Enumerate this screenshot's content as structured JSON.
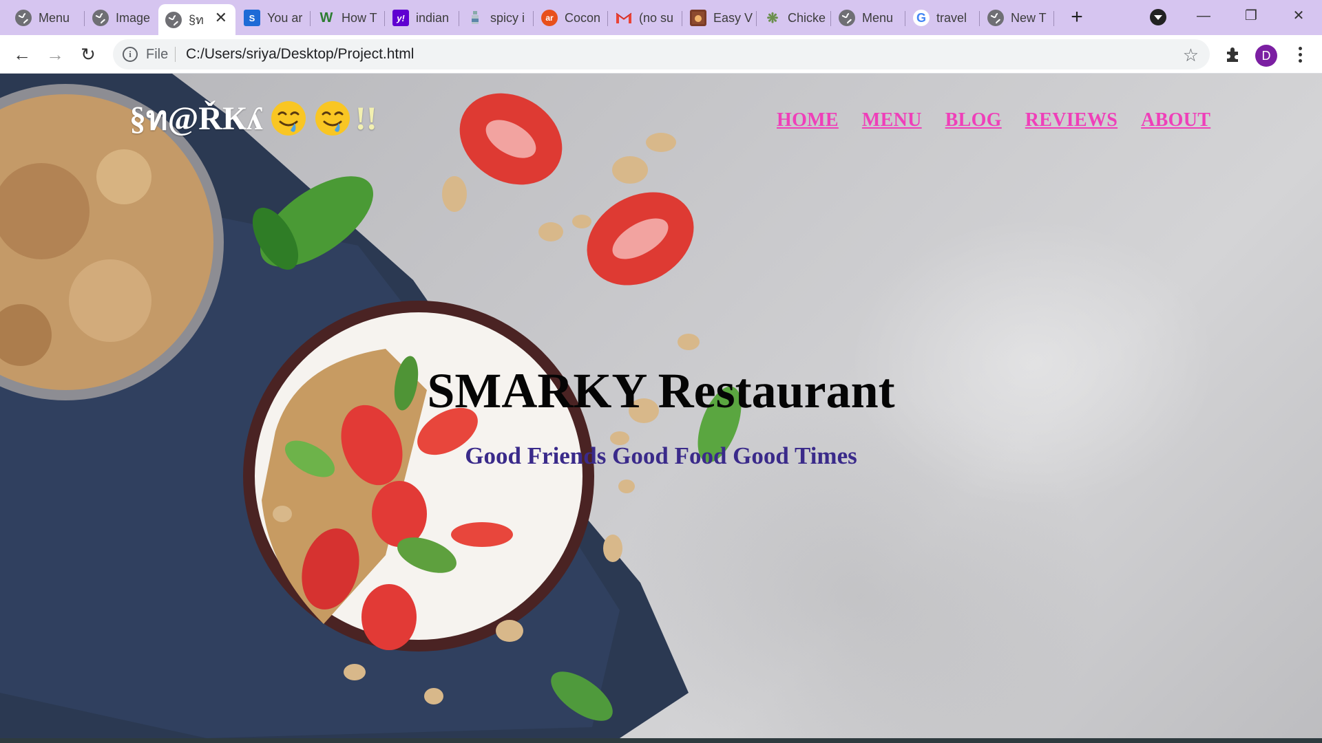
{
  "browser": {
    "tabs": [
      {
        "title": "Menu",
        "favicon": "globe-icon"
      },
      {
        "title": "Image",
        "favicon": "globe-icon"
      },
      {
        "title": "§ท",
        "favicon": "globe-icon",
        "active": true
      },
      {
        "title": "You ar",
        "favicon": "s-icon"
      },
      {
        "title": "How T",
        "favicon": "w-icon"
      },
      {
        "title": "indian",
        "favicon": "yahoo-icon"
      },
      {
        "title": "spicy i",
        "favicon": "bottle-icon"
      },
      {
        "title": "Cocon",
        "favicon": "allrecipes-icon"
      },
      {
        "title": "(no su",
        "favicon": "gmail-icon"
      },
      {
        "title": "Easy V",
        "favicon": "image-icon"
      },
      {
        "title": "Chicke",
        "favicon": "leaf-icon"
      },
      {
        "title": "Menu",
        "favicon": "globe-icon"
      },
      {
        "title": "travel",
        "favicon": "google-icon"
      },
      {
        "title": "New T",
        "favicon": "globe-icon"
      }
    ],
    "address": {
      "scheme": "File",
      "url": "C:/Users/sriya/Desktop/Project.html"
    },
    "profile_initial": "D",
    "colors": {
      "tabstrip": "#d6c5f0",
      "profile": "#7b1fa2"
    }
  },
  "site": {
    "brand": {
      "text": "§ท@ŘКʎ",
      "suffix": "!!",
      "emoji": "drooling-face-icon"
    },
    "nav": [
      "HOME",
      "MENU",
      "BLOG",
      "REVIEWS",
      "ABOUT"
    ],
    "hero": {
      "title": "SMARKY Restaurant",
      "subtitle": "Good Friends Good Food Good Times"
    },
    "colors": {
      "nav": "#ef3fb9",
      "subtitle": "#3a2a8a",
      "title": "#050505"
    }
  }
}
